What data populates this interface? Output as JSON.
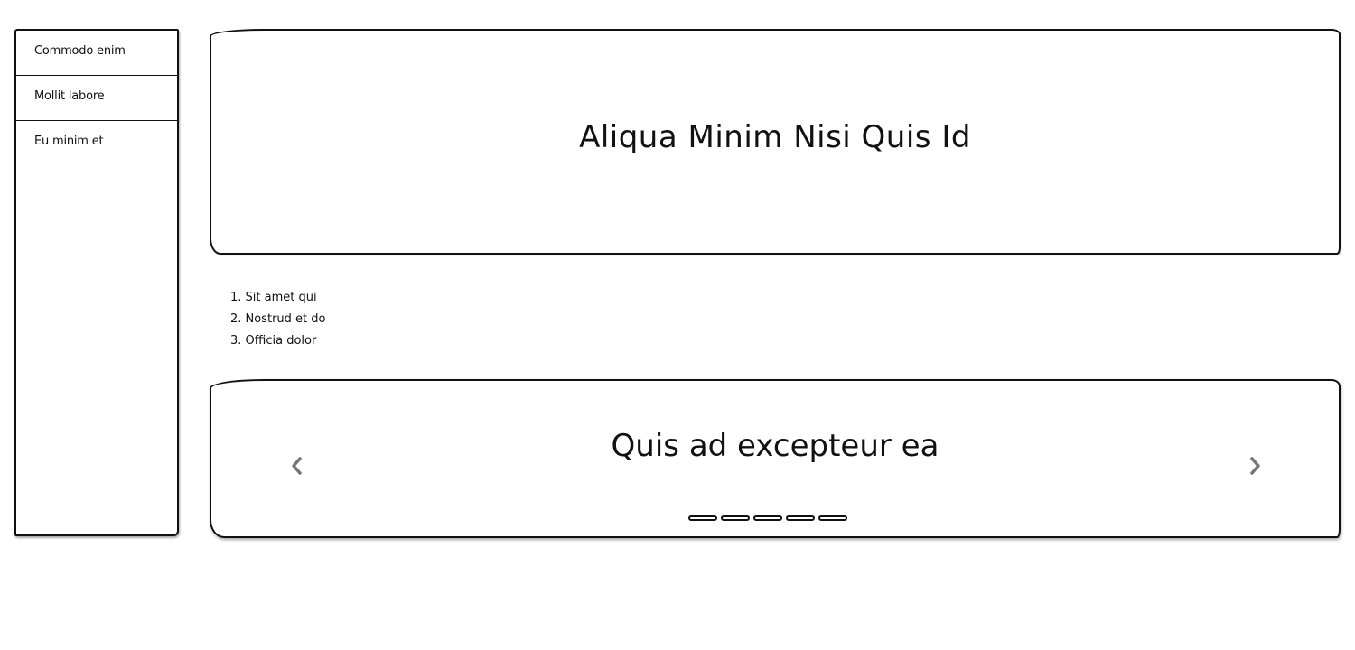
{
  "sidebar": {
    "items": [
      {
        "label": "Commodo enim"
      },
      {
        "label": "Mollit labore"
      },
      {
        "label": "Eu minim et"
      }
    ]
  },
  "hero": {
    "title": "Aliqua Minim Nisi Quis Id"
  },
  "list": {
    "items": [
      {
        "label": "1. Sit amet qui"
      },
      {
        "label": "2. Nostrud et do"
      },
      {
        "label": "3. Officia dolor"
      }
    ]
  },
  "carousel": {
    "title": "Quis ad excepteur ea",
    "prev_icon": "chevron-left-icon",
    "next_icon": "chevron-right-icon",
    "arrow_color": "#777777",
    "slide_count": 5
  }
}
